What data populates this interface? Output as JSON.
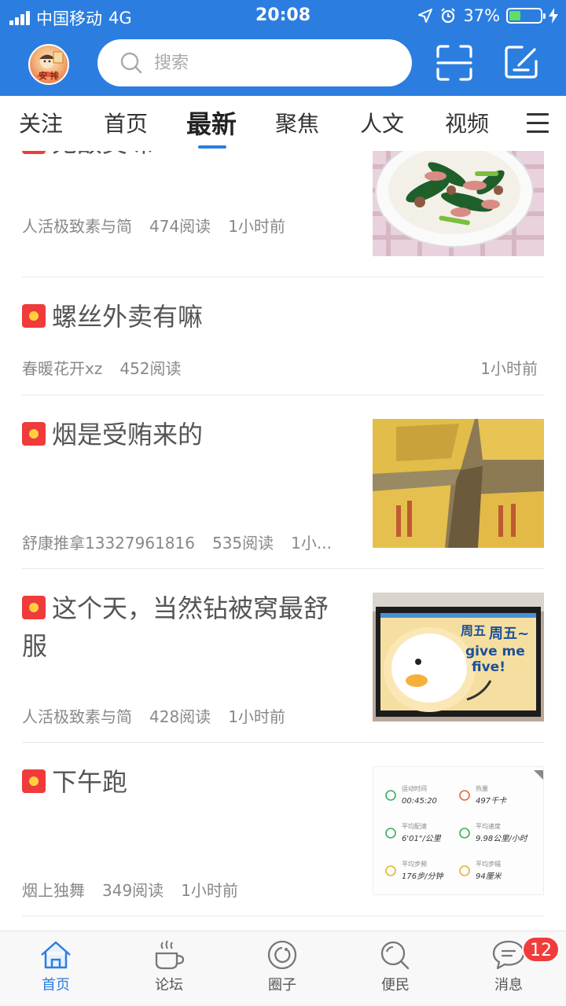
{
  "status_bar": {
    "carrier": "中国移动",
    "network": "4G",
    "time": "20:08",
    "battery_percent": "37%",
    "battery_level": 0.37
  },
  "header": {
    "avatar_text": "安 排",
    "search_placeholder": "搜索"
  },
  "tabs": [
    {
      "label": "关注"
    },
    {
      "label": "首页"
    },
    {
      "label": "最新",
      "active": true
    },
    {
      "label": "聚焦"
    },
    {
      "label": "人文"
    },
    {
      "label": "视频"
    }
  ],
  "feed": [
    {
      "title": "无敌美味",
      "author": "人活极致素与简",
      "reads": "474阅读",
      "time": "1小时前",
      "thumb": "food-photo"
    },
    {
      "title": "螺丝外卖有嘛",
      "author": "春暖花开xz",
      "reads": "452阅读",
      "time": "1小时前",
      "thumb": null
    },
    {
      "title": "烟是受贿来的",
      "author": "舒康推拿13327961816",
      "reads": "535阅读",
      "time": "1小...",
      "thumb": "cigarette-boxes-photo"
    },
    {
      "title": "这个天，当然钻被窝最舒服",
      "author": "人活极致素与简",
      "reads": "428阅读",
      "time": "1小时前",
      "thumb": "cartoon-duck-monitor-photo",
      "thumb_text": {
        "line1": "周五",
        "line2": "周五~",
        "line3": "give me",
        "line4": "five!"
      }
    },
    {
      "title": "下午跑",
      "author": "烟上独舞",
      "reads": "349阅读",
      "time": "1小时前",
      "thumb": "running-stats-screenshot",
      "stats": [
        {
          "label": "运动时间",
          "value": "00:45:20"
        },
        {
          "label": "热量",
          "value": "497千卡"
        },
        {
          "label": "平均配速",
          "value": "6'01\"/公里"
        },
        {
          "label": "平均速度",
          "value": "9.98公里/小时"
        },
        {
          "label": "平均步频",
          "value": "176步/分钟"
        },
        {
          "label": "平均步幅",
          "value": "94厘米"
        }
      ]
    }
  ],
  "bottom_nav": [
    {
      "label": "首页",
      "icon": "home-icon",
      "active": true
    },
    {
      "label": "论坛",
      "icon": "coffee-cup-icon"
    },
    {
      "label": "圈子",
      "icon": "circle-icon"
    },
    {
      "label": "便民",
      "icon": "search-icon"
    },
    {
      "label": "消息",
      "icon": "chat-bubble-icon",
      "badge": "12"
    }
  ],
  "colors": {
    "brand_blue": "#2b7ee0",
    "badge_red": "#ef3b3b",
    "notification_red": "#f03c3c"
  }
}
